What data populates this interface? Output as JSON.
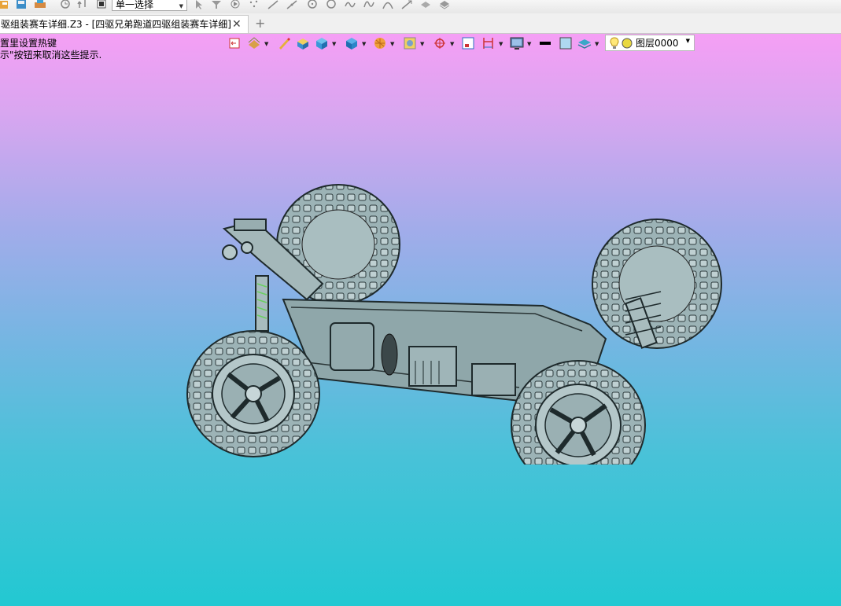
{
  "toolbar": {
    "select_mode_value": "单一选择",
    "icons": [
      "file-icon",
      "save-icon",
      "print-icon",
      "history-icon",
      "redo-icon",
      "stop-icon",
      "pick-arrow-icon",
      "filter-icon",
      "play-icon",
      "point-icon",
      "line-icon",
      "line-icon",
      "circle-icon",
      "circle-icon",
      "curve-icon",
      "spline-icon",
      "arc-icon",
      "line-icon",
      "surface-icon",
      "surface-icon"
    ]
  },
  "tabs": {
    "active_title": "驱组装赛车详细.Z3 - [四驱兄弟跑道四驱组装赛车详细]",
    "close_symbol": "✕",
    "add_symbol": "+"
  },
  "viewport": {
    "hint_line_1": "置里设置热键",
    "hint_line_2": "示\"按钮来取消这些提示.",
    "layer_name": "图层0000",
    "gradient_top": "#f59ff5",
    "gradient_bottom": "#22c8d2",
    "model_color": "#9bb2b5"
  },
  "view_toolbar": {
    "icons": [
      "view-restore-icon",
      "filter-layers-icon",
      "pen-icon",
      "shaded-box-icon",
      "cube-view-icon",
      "cube-dropdown-icon",
      "sphere-render-icon",
      "image-icon",
      "snap-icon",
      "frame-icon",
      "dimension-icon",
      "display-icon",
      "line-color-icon",
      "fill-color-icon",
      "layers-icon",
      "light-bulb-icon",
      "layer-color-icon"
    ]
  }
}
